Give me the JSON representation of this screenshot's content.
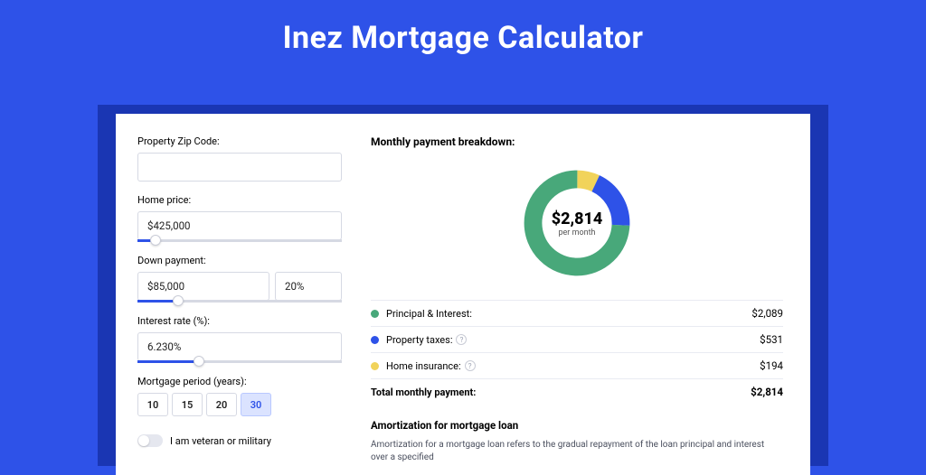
{
  "title": "Inez Mortgage Calculator",
  "form": {
    "zip_label": "Property Zip Code:",
    "zip_value": "",
    "price_label": "Home price:",
    "price_value": "$425,000",
    "price_slider_pct": 9,
    "down_label": "Down payment:",
    "down_amount": "$85,000",
    "down_pct": "20%",
    "down_slider_pct": 20,
    "rate_label": "Interest rate (%):",
    "rate_value": "6.230%",
    "rate_slider_pct": 30,
    "period_label": "Mortgage period (years):",
    "period_options": [
      "10",
      "15",
      "20",
      "30"
    ],
    "period_selected": "30",
    "veteran_label": "I am veteran or military"
  },
  "breakdown": {
    "title": "Monthly payment breakdown:",
    "total_amount": "$2,814",
    "per_month": "per month",
    "items": [
      {
        "label": "Principal & Interest:",
        "value": "$2,089",
        "color": "#48a87a",
        "info": false
      },
      {
        "label": "Property taxes:",
        "value": "$531",
        "color": "#2e52e8",
        "info": true
      },
      {
        "label": "Home insurance:",
        "value": "$194",
        "color": "#f1d35a",
        "info": true
      }
    ],
    "total_label": "Total monthly payment:",
    "total_value": "$2,814"
  },
  "amort": {
    "title": "Amortization for mortgage loan",
    "text": "Amortization for a mortgage loan refers to the gradual repayment of the loan principal and interest over a specified"
  },
  "chart_data": {
    "type": "pie",
    "title": "Monthly payment breakdown",
    "series": [
      {
        "name": "Principal & Interest",
        "value": 2089,
        "color": "#48a87a"
      },
      {
        "name": "Property taxes",
        "value": 531,
        "color": "#2e52e8"
      },
      {
        "name": "Home insurance",
        "value": 194,
        "color": "#f1d35a"
      }
    ],
    "total": 2814,
    "unit": "USD/month"
  }
}
